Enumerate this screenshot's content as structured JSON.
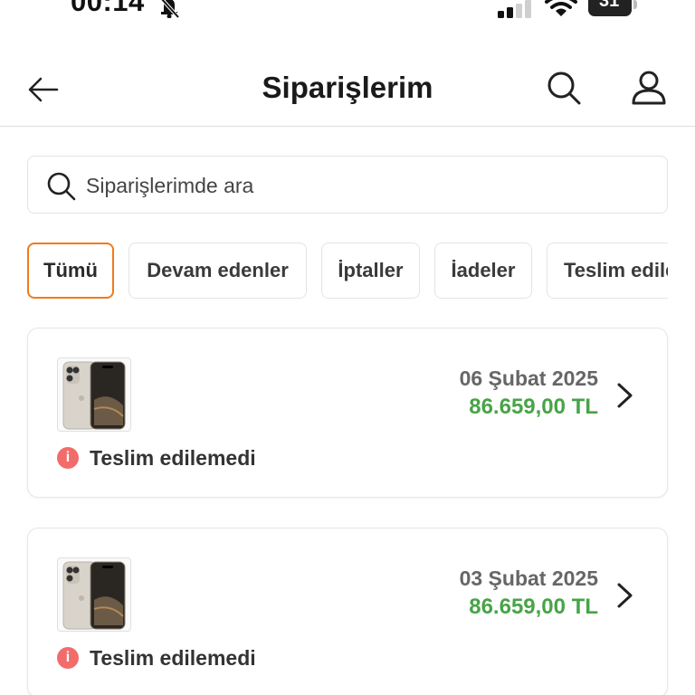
{
  "status_bar": {
    "time": "00:14",
    "battery": "31"
  },
  "header": {
    "title": "Siparişlerim"
  },
  "search": {
    "placeholder": "Siparişlerimde ara"
  },
  "filters": [
    {
      "label": "Tümü",
      "active": true
    },
    {
      "label": "Devam edenler",
      "active": false
    },
    {
      "label": "İptaller",
      "active": false
    },
    {
      "label": "İadeler",
      "active": false
    },
    {
      "label": "Teslim edilenler",
      "active": false
    }
  ],
  "orders": [
    {
      "date": "06 Şubat 2025",
      "price": "86.659,00 TL",
      "status": "Teslim edilemedi"
    },
    {
      "date": "03 Şubat 2025",
      "price": "86.659,00 TL",
      "status": "Teslim edilemedi"
    }
  ],
  "colors": {
    "accent": "#f27a1a",
    "price_green": "#47a447",
    "error_red": "#f26c6c"
  }
}
